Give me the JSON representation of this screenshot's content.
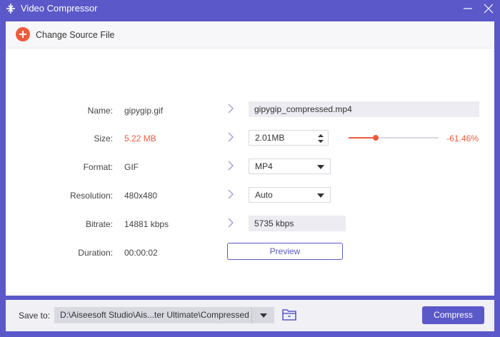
{
  "window": {
    "title": "Video Compressor",
    "accent_color": "#5b58c9",
    "highlight_color": "#f05a3a"
  },
  "source": {
    "label": "Change Source File"
  },
  "rows": {
    "name": {
      "label": "Name:",
      "original": "gipygip.gif",
      "output": "gipygip_compressed.mp4"
    },
    "size": {
      "label": "Size:",
      "original": "5.22 MB",
      "output": "2.01MB",
      "slider_fraction": 0.3,
      "percent": "-61.46%"
    },
    "format": {
      "label": "Format:",
      "original": "GIF",
      "output": "MP4"
    },
    "resolution": {
      "label": "Resolution:",
      "original": "480x480",
      "output": "Auto"
    },
    "bitrate": {
      "label": "Bitrate:",
      "original": "14881 kbps",
      "output": "5735 kbps"
    },
    "duration": {
      "label": "Duration:",
      "original": "00:00:02"
    }
  },
  "preview": {
    "label": "Preview"
  },
  "bottom": {
    "save_label": "Save to:",
    "path": "D:\\Aiseesoft Studio\\Ais...ter Ultimate\\Compressed",
    "compress_label": "Compress"
  }
}
